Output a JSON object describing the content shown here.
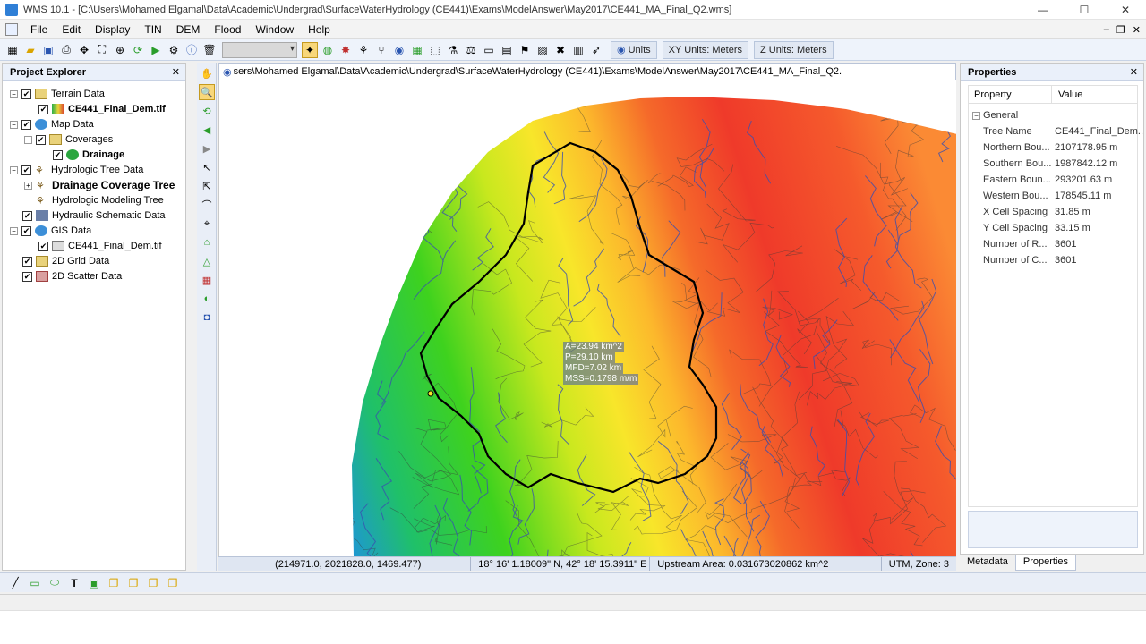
{
  "window": {
    "title": "WMS 10.1 - [C:\\Users\\Mohamed Elgamal\\Data\\Academic\\Undergrad\\SurfaceWaterHydrology (CE441)\\Exams\\ModelAnswer\\May2017\\CE441_MA_Final_Q2.wms]",
    "minimize": "—",
    "maximize": "☐",
    "close": "✕"
  },
  "menu": [
    "File",
    "Edit",
    "Display",
    "TIN",
    "DEM",
    "Flood",
    "Window",
    "Help"
  ],
  "mdi_controls": {
    "minimize": "–",
    "restore": "❐",
    "close": "✕"
  },
  "toolbar": {
    "units_label": "Units",
    "xy_units": "XY Units: Meters",
    "z_units": "Z Units: Meters"
  },
  "project_explorer": {
    "title": "Project Explorer",
    "close": "✕",
    "items": [
      "Terrain Data",
      "CE441_Final_Dem.tif",
      "Map Data",
      "Coverages",
      "Drainage",
      "Hydrologic Tree Data",
      "Drainage Coverage Tree",
      "Hydrologic Modeling Tree",
      "Hydraulic Schematic Data",
      "GIS Data",
      "CE441_Final_Dem.tif",
      "2D Grid Data",
      "2D Scatter Data"
    ]
  },
  "document": {
    "path": "sers\\Mohamed Elgamal\\Data\\Academic\\Undergrad\\SurfaceWaterHydrology (CE441)\\Exams\\ModelAnswer\\May2017\\CE441_MA_Final_Q2."
  },
  "map": {
    "annotations": [
      "A=23.94 km^2",
      "P=29.10 km",
      "MFD=7.02 km",
      "MSS=0.1798 m/m"
    ]
  },
  "status": {
    "coords": "(214971.0, 2021828.0, 1469.477)",
    "latlon": "18° 16' 1.18009\" N, 42° 18' 15.3911\" E",
    "upstream": "Upstream Area: 0.031673020862 km^2",
    "projection": "UTM, Zone: 3"
  },
  "properties": {
    "title": "Properties",
    "close": "✕",
    "header_property": "Property",
    "header_value": "Value",
    "group": "General",
    "rows": [
      {
        "k": "Tree Name",
        "v": "CE441_Final_Dem..."
      },
      {
        "k": "Northern Bou...",
        "v": "2107178.95 m"
      },
      {
        "k": "Southern Bou...",
        "v": "1987842.12 m"
      },
      {
        "k": "Eastern Boun...",
        "v": "293201.63 m"
      },
      {
        "k": "Western Bou...",
        "v": "178545.11 m"
      },
      {
        "k": "X Cell Spacing",
        "v": "31.85 m"
      },
      {
        "k": "Y Cell Spacing",
        "v": "33.15 m"
      },
      {
        "k": "Number of R...",
        "v": "3601"
      },
      {
        "k": "Number of C...",
        "v": "3601"
      }
    ],
    "tabs": [
      "Metadata",
      "Properties"
    ]
  },
  "colors": {
    "panel_header": "#eaf0fa",
    "watershed_boundary": "#000000",
    "stream": "#3a4fb0"
  }
}
